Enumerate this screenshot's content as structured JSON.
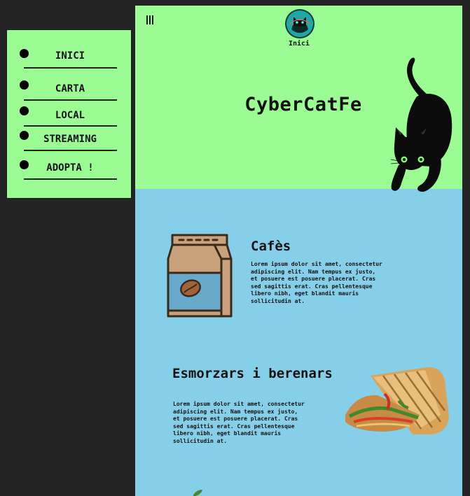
{
  "sidebar": {
    "items": [
      {
        "label": "INICI"
      },
      {
        "label": "CARTA"
      },
      {
        "label": "LOCAL"
      },
      {
        "label": "STREAMING"
      },
      {
        "label": "ADOPTA !"
      }
    ]
  },
  "header": {
    "logo_label": "Inici",
    "title": "CyberCatFe"
  },
  "sections": [
    {
      "title": "Cafès",
      "text": "Lorem ipsum dolor sit amet, consectetur adipiscing elit. Nam tempus ex justo, et posuere est posuere placerat. Cras sed sagittis erat. Cras pellentesque libero nibh, eget blandit mauris sollicitudin at."
    },
    {
      "title": "Esmorzars i berenars",
      "text": "Lorem ipsum dolor sit amet, consectetur adipiscing elit. Nam tempus ex justo, et posuere est posuere placerat. Cras sed sagittis erat. Cras pellentesque libero nibh, eget blandit mauris sollicitudin at."
    }
  ],
  "colors": {
    "background": "#242424",
    "green": "#9cfc94",
    "blue": "#86cfe9",
    "text": "#111111"
  },
  "icons": [
    "menu-icon",
    "cat-logo-icon",
    "cat-illustration",
    "coffee-bag-icon",
    "sandwich-image"
  ]
}
